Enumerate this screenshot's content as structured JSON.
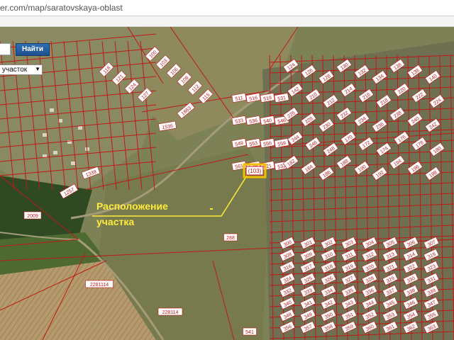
{
  "browser": {
    "url": "er.com/map/saratovskaya-oblast"
  },
  "toolbar": {
    "search_value": "",
    "find_label": "Найти",
    "type_select": "участок"
  },
  "annotation": {
    "line1": "Расположение",
    "line2": "участка"
  },
  "highlight": {
    "label": "(103)"
  },
  "colors": {
    "parcel": "#c01818",
    "label_bg": "#ffffff",
    "annotation": "#ffeb3b",
    "highlight": "#e0b000"
  },
  "parcel_labels_left": [
    "1863",
    "1536",
    "1339",
    "1257",
    "2009"
  ],
  "parcel_labels_center": [
    "511",
    "516",
    "519",
    "531",
    "533",
    "536",
    "540",
    "546",
    "549",
    "553",
    "556",
    "559",
    "561",
    "519",
    "521",
    "532"
  ],
  "parcel_labels_mid": [
    "288",
    "2281114",
    "228114",
    "541"
  ],
  "parcel_labels_right": [
    "124",
    "126",
    "128",
    "130",
    "132",
    "134",
    "136",
    "138",
    "140",
    "142",
    "210",
    "212",
    "214",
    "216",
    "218",
    "220",
    "222",
    "224",
    "226",
    "228",
    "230",
    "232",
    "234",
    "236",
    "238",
    "240",
    "242",
    "244",
    "246",
    "248",
    "170",
    "172",
    "174",
    "176",
    "178",
    "180",
    "182",
    "184",
    "186",
    "188",
    "190",
    "192",
    "194",
    "196",
    "198"
  ]
}
